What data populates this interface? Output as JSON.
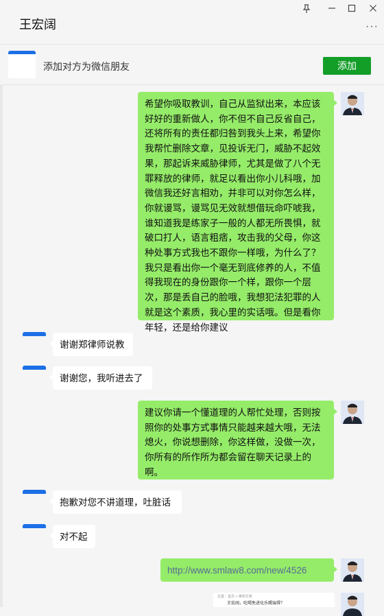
{
  "window": {
    "title": "王宏阔",
    "pin_icon": "pin-icon",
    "minimize_icon": "minimize-icon",
    "maximize_icon": "maximize-icon",
    "close_icon": "close-icon",
    "more_icon": "more-icon"
  },
  "add_bar": {
    "prompt": "添加对方为微信朋友",
    "button_label": "添加",
    "button_color": "#139e28"
  },
  "colors": {
    "my_bubble": "#95ec69",
    "other_bubble": "#ffffff",
    "accent_blue": "#1c6fe6"
  },
  "messages": [
    {
      "from": "me",
      "text": "希望你吸取教训，自己从监狱出来，本应该好好的重新做人，你不但不自己反省自己，还将所有的责任都归咎到我头上来，希望你我帮忙删除文章，见投诉无门，威胁不起效果，那起诉来威胁律师，尤其是做了八个无罪释放的律师，就足以看出你小儿科哦，加微信我还好言相劝，并非可以对你怎么样，你就谩骂，谩骂见无效就想借玩命吓唬我，谁知道我是练家子一般的人都无所畏惧，就破口打人，语言粗痞，攻击我的父母，你这种处事方式我也不跟你一样哦，为什么了？我只是看出你一个毫无到底修养的人，不值得我现在的身份跟你一个样，跟你一个层次，那是丢自己的脸哦，我想犯法犯罪的人就是这个素质，我心里的实话哦。但是看你年轻，还是给你建议"
    },
    {
      "from": "other",
      "text": "谢谢郑律师说教"
    },
    {
      "from": "other",
      "text": "谢谢您，我听进去了"
    },
    {
      "from": "me",
      "text": "建议你请一个懂道理的人帮忙处理，否则按照你的处事方式事情只能越来越大哦，无法熄火，你说想删除，你这样做，没做一次，你所有的所作所为都会留在聊天记录上的啊。"
    },
    {
      "from": "other",
      "text": "抱歉对您不讲道理，吐脏话"
    },
    {
      "from": "other",
      "text": "对不起"
    },
    {
      "from": "me",
      "text": "http://www.smlaw8.com/new/4526"
    }
  ],
  "link_card": {
    "breadcrumb": "位置：首页 > 律师文章",
    "headline": "王宏阔，吃喝免进化乐赐瑞得？"
  }
}
